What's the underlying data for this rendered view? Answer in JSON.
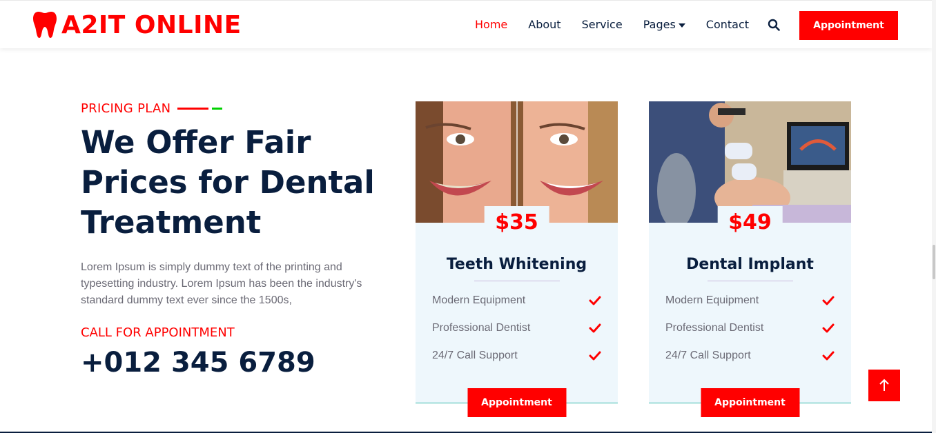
{
  "brand": {
    "name": "A2IT ONLINE",
    "icon": "tooth-icon",
    "color": "#FF0000"
  },
  "nav": {
    "items": [
      {
        "label": "Home",
        "active": true
      },
      {
        "label": "About",
        "active": false
      },
      {
        "label": "Service",
        "active": false
      },
      {
        "label": "Pages",
        "active": false,
        "dropdown": true
      },
      {
        "label": "Contact",
        "active": false
      }
    ],
    "search_icon": "search-icon",
    "cta_label": "Appointment"
  },
  "pricing": {
    "eyebrow": "PRICING PLAN",
    "headline": "We Offer Fair Prices for Dental Treatment",
    "paragraph": "Lorem Ipsum is simply dummy text of the printing and typesetting industry. Lorem Ipsum has been the industry's standard dummy text ever since the 1500s,",
    "call_label": "CALL FOR APPOINTMENT",
    "phone": "+012 345 6789"
  },
  "cards": [
    {
      "price": "$35",
      "title": "Teeth Whitening",
      "features": [
        "Modern Equipment",
        "Professional Dentist",
        "24/7 Call Support"
      ],
      "button": "Appointment"
    },
    {
      "price": "$49",
      "title": "Dental Implant",
      "features": [
        "Modern Equipment",
        "Professional Dentist",
        "24/7 Call Support"
      ],
      "button": "Appointment"
    }
  ],
  "colors": {
    "accent": "#FF0000",
    "dark": "#091E3E",
    "card_bg": "#EEF7FC",
    "eyebrow_line_green": "#00D000"
  },
  "scroll_top_icon": "arrow-up-icon"
}
